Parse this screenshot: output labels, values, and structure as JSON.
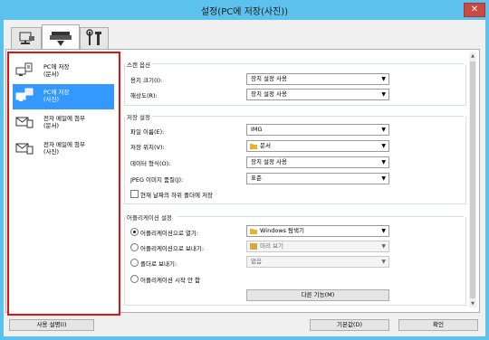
{
  "window": {
    "title": "설정(PC에 저장(사진))",
    "close_glyph": "✕"
  },
  "tabs": [
    {
      "icon": "scanner-computer-icon"
    },
    {
      "icon": "scanner-icon"
    },
    {
      "icon": "tools-icon"
    }
  ],
  "sidebar": {
    "items": [
      {
        "label": "PC에 저장\n(문서)",
        "icon": "document-save-icon",
        "selected": false
      },
      {
        "label": "PC에 저장\n(사진)",
        "icon": "photo-save-icon",
        "selected": true
      },
      {
        "label": "전자 메일에 첨부\n(문서)",
        "icon": "mail-attach-icon",
        "selected": false
      },
      {
        "label": "전자 메일에 첨부\n(사진)",
        "icon": "mail-attach-icon",
        "selected": false
      }
    ]
  },
  "scan_options": {
    "title": "스캔 옵션",
    "paper_size_label": "용지 크기(I):",
    "paper_size_value": "장치 설정 사용",
    "resolution_label": "해상도(R):",
    "resolution_value": "장치 설정 사용"
  },
  "save_settings": {
    "title": "저장 설정",
    "filename_label": "파일 이름(E):",
    "filename_value": "IMG",
    "location_label": "저장 위치(V):",
    "location_value": "문서",
    "format_label": "데이터 형식(O):",
    "format_value": "장치 설정 사용",
    "jpeg_label": "JPEG 이미지 품질(J):",
    "jpeg_value": "표준",
    "subfolder_label": "현재 날짜의 하위 폴더에 저장"
  },
  "app_settings": {
    "title": "어플리케이션 설정",
    "open_label": "어플리케이션으로 열기:",
    "open_value": "Windows 탐색기",
    "send_label": "어플리케이션으로 보내기:",
    "send_value": "미리 보기",
    "folder_label": "폴더로 보내기:",
    "folder_value": "없음",
    "none_label": "어플리케이션 시작 안 함",
    "more_functions": "다른 기능(M)"
  },
  "footer": {
    "instructions": "사용 설명(I)",
    "defaults": "기본값(D)",
    "ok": "확인"
  }
}
